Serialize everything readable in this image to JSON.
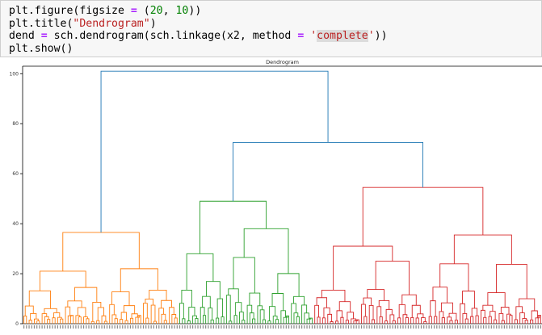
{
  "code_cell": {
    "lines": [
      [
        {
          "t": "plt.figure(figsize "
        },
        {
          "t": "=",
          "c": "o"
        },
        {
          "t": " ("
        },
        {
          "t": "20",
          "c": "n"
        },
        {
          "t": ", "
        },
        {
          "t": "10",
          "c": "n"
        },
        {
          "t": "))"
        }
      ],
      [
        {
          "t": "plt.title("
        },
        {
          "t": "\"Dendrogram\"",
          "c": "s"
        },
        {
          "t": ")"
        }
      ],
      [
        {
          "t": "dend "
        },
        {
          "t": "=",
          "c": "o"
        },
        {
          "t": " sch.dendrogram(sch.linkage(x2, method "
        },
        {
          "t": "=",
          "c": "o"
        },
        {
          "t": " "
        },
        {
          "t": "'",
          "c": "s"
        },
        {
          "t": "complete",
          "c": "s hl"
        },
        {
          "t": "'",
          "c": "s"
        },
        {
          "t": "))"
        }
      ],
      [
        {
          "t": "plt.show()"
        }
      ]
    ]
  },
  "chart_data": {
    "type": "dendrogram",
    "title": "Dendrogram",
    "xlabel": "",
    "ylabel": "",
    "ylim": [
      0,
      103
    ],
    "yticks": [
      0,
      20,
      40,
      60,
      80,
      100
    ],
    "leaf_count": 200,
    "grid": false,
    "colors": {
      "orange": "#ff7f0e",
      "green": "#2ca02c",
      "red": "#d62728",
      "blue": "#1f77b4"
    },
    "root_height": 101,
    "top_links": [
      {
        "left": "orange cluster",
        "right": "green+red",
        "height": 101,
        "color": "#1f77b4"
      },
      {
        "left": "green cluster",
        "right": "red cluster",
        "height": 72.5,
        "color": "#1f77b4"
      }
    ],
    "clusters": [
      {
        "color": "#ff7f0e",
        "leaves": 60,
        "height": 36.5,
        "sub": [
          {
            "leaves": 33,
            "height": 21,
            "sub": [
              {
                "leaves": 16,
                "height": 14
              },
              {
                "leaves": 17,
                "height": 16
              }
            ]
          },
          {
            "leaves": 27,
            "height": 22,
            "sub": [
              {
                "leaves": 13,
                "height": 14
              },
              {
                "leaves": 14,
                "height": 14
              }
            ]
          }
        ]
      },
      {
        "color": "#2ca02c",
        "leaves": 52,
        "height": 49,
        "sub": [
          {
            "leaves": 18,
            "height": 28,
            "sub": [
              {
                "leaves": 8,
                "height": 15
              },
              {
                "leaves": 10,
                "height": 17
              }
            ]
          },
          {
            "leaves": 34,
            "height": 38,
            "sub": [
              {
                "leaves": 16,
                "height": 29
              },
              {
                "leaves": 18,
                "height": 22
              }
            ]
          }
        ]
      },
      {
        "color": "#d62728",
        "leaves": 88,
        "height": 54.5,
        "sub": [
          {
            "leaves": 44,
            "height": 31,
            "sub": [
              {
                "leaves": 18,
                "height": 14
              },
              {
                "leaves": 26,
                "height": 29
              }
            ]
          },
          {
            "leaves": 44,
            "height": 35.5,
            "sub": [
              {
                "leaves": 20,
                "height": 24
              },
              {
                "leaves": 24,
                "height": 24
              }
            ]
          }
        ]
      }
    ]
  }
}
